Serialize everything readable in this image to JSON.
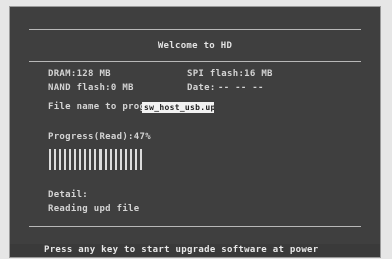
{
  "title": "Welcome to HD",
  "info": {
    "dram": "DRAM:128 MB",
    "spi": "SPI flash:16 MB",
    "nand": "NAND flash:0 MB",
    "date_label": "Date:",
    "date_value": "-- -- --",
    "filename_label": "File name to program:",
    "filename_value": "sw_host_usb.upd"
  },
  "progress": {
    "label": "Progress(Read):47%",
    "percent": 47,
    "segments_total": 19,
    "segments_filled": 19
  },
  "detail": {
    "label": "Detail:",
    "value": "Reading upd file"
  },
  "footer": "Press any key to start upgrade software at power",
  "colors": {
    "console_bg": "#3f3f3f",
    "text": "#d4d4d4",
    "input_bg": "#f2f2f2",
    "segment": "#dcdcdc"
  }
}
